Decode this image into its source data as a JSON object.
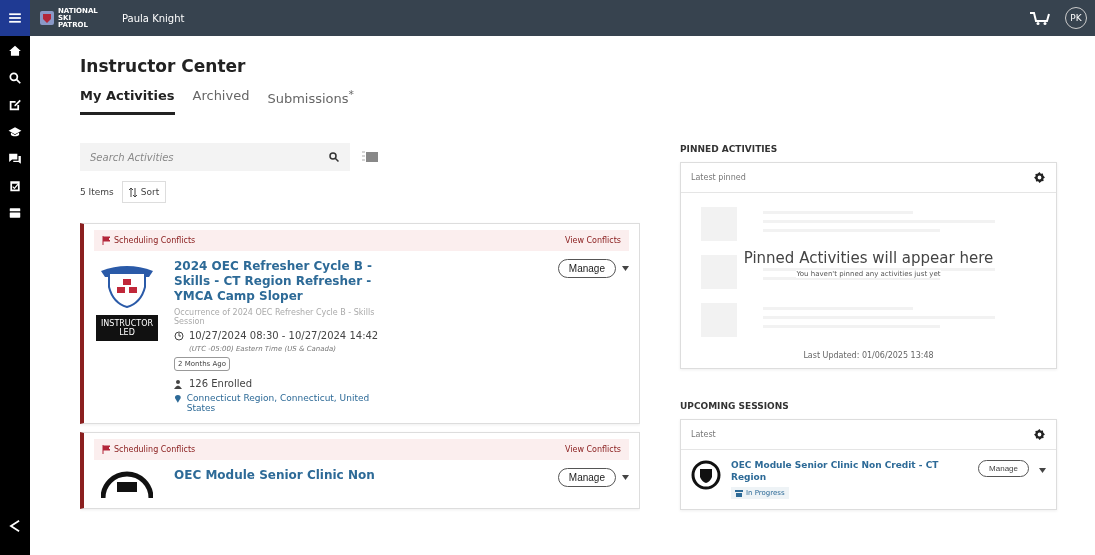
{
  "header": {
    "brand": "NATIONAL SKI PATROL",
    "user": "Paula Knight",
    "avatar": "PK"
  },
  "page": {
    "title": "Instructor Center"
  },
  "tabs": [
    {
      "label": "My Activities",
      "selected": true
    },
    {
      "label": "Archived",
      "selected": false
    },
    {
      "label": "Submissions$^{*}$",
      "selected": false
    }
  ],
  "search": {
    "placeholder": "Search Activities"
  },
  "list": {
    "count": "5 Items",
    "sort": "Sort"
  },
  "activities": [
    {
      "kind": "full",
      "alert": "Scheduling Conflicts",
      "alert_link": "View Conflicts",
      "title": "2024 OEC Refresher Cycle B - Skills - CT Region Refresher - YMCA Camp Sloper",
      "badge": "INSTRUCTOR LED",
      "subtitle": "Occurrence of 2024 OEC Refresher Cycle B - Skills Session",
      "time": "10/27/2024 08:30 - 10/27/2024 14:42",
      "timezone": "(UTC -05:00) Eastern Time (US & Canada)",
      "ago": "2 Months Ago",
      "enrolled": "126 Enrolled",
      "location": "Connecticut Region, Connecticut, United States",
      "action": "Manage"
    },
    {
      "kind": "partial",
      "alert": "Scheduling Conflicts",
      "alert_link": "View Conflicts",
      "title": "OEC Module Senior Clinic Non",
      "action": "Manage"
    }
  ],
  "pinned": {
    "heading": "PINNED ACTIVITIES",
    "filter": "Latest pinned",
    "empty_title": "Pinned Activities will appear here",
    "empty_text": "You haven't pinned any activities just yet",
    "updated": "Last Updated: 01/06/2025 13:48"
  },
  "upcoming": {
    "heading": "UPCOMING SESSIONS",
    "filter": "Latest",
    "items": [
      {
        "title": "OEC Module Senior Clinic Non Credit - CT Region",
        "status": "In Progress",
        "action": "Manage"
      }
    ]
  }
}
